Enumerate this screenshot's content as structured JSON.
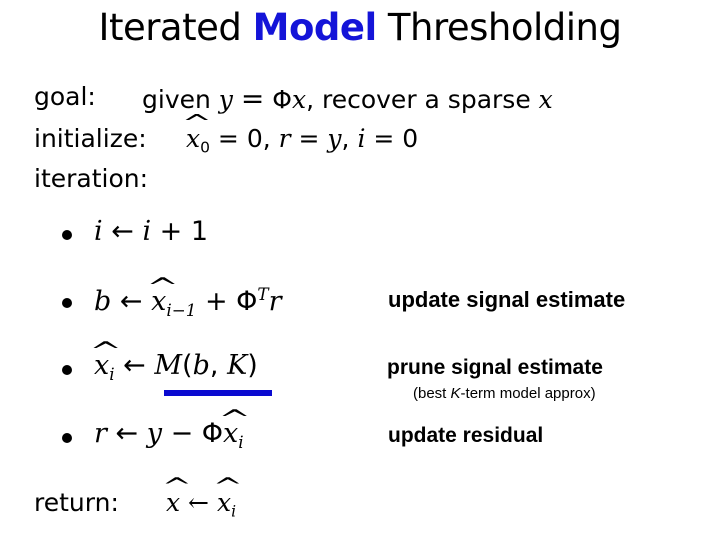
{
  "title": {
    "before": "Iterated ",
    "highlight": "Model",
    "after": " Thresholding",
    "highlight_color": "#1414d8"
  },
  "goal": {
    "label": "goal:",
    "text_given": "given",
    "eq_lhs": "y",
    "eq_sign": "=",
    "eq_phi": "Φ",
    "eq_x": "x",
    "text_recover": ", recover a sparse",
    "var": "x"
  },
  "initialize": {
    "label": "initialize:",
    "x_hat": "x",
    "x_sub": "0",
    "eq1": " = 0, ",
    "r": "r",
    "eq2": " = ",
    "y": "y",
    "comma": ", ",
    "i": "i",
    "eq3": " = 0"
  },
  "iteration": {
    "label": "iteration:",
    "steps": [
      {
        "expr_parts": [
          "i",
          " ← ",
          "i",
          " + 1"
        ]
      },
      {
        "lhs": "b",
        "arrow": " ← ",
        "x": "x",
        "sub": "i−1",
        "plus": " + ",
        "phi": "Φ",
        "sup": "T",
        "r": "r"
      },
      {
        "lhs_x": "x",
        "lhs_sub": "i",
        "arrow": " ← ",
        "M": "M",
        "args": "(",
        "b": "b",
        "comma": ", ",
        "K": "K",
        "close": ")"
      },
      {
        "lhs": "r",
        "arrow": " ← ",
        "y": "y",
        "minus": " − ",
        "phi": "Φ",
        "x": "x",
        "sub": "i"
      }
    ]
  },
  "annotations": {
    "update_signal": "update signal estimate",
    "prune_signal": "prune signal estimate",
    "prune_note_open": "(best ",
    "prune_note_K": "K",
    "prune_note_rest": "-term model approx)",
    "update_residual": "update residual"
  },
  "return": {
    "label": "return:",
    "x_hat": "x",
    "arrow": " ← ",
    "x_hat_i": "x",
    "sub": "i"
  },
  "underline_color": "#0a0ad0"
}
